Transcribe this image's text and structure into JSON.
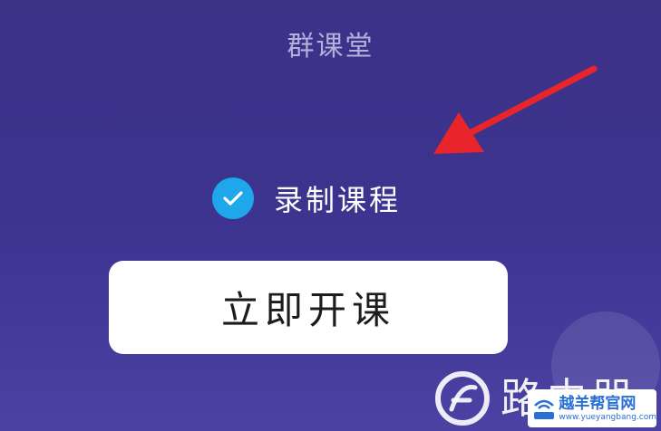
{
  "page": {
    "title": "群课堂"
  },
  "record_option": {
    "label": "录制课程",
    "checked": true
  },
  "start_button": {
    "label": "立即开课"
  },
  "watermark": {
    "text": "路由器",
    "site_name": "越羊帮官网",
    "site_url": "www.yueyangbang.com"
  },
  "colors": {
    "background": "#3b338d",
    "check": "#1fa7ec",
    "arrow": "#e8252b",
    "button": "#ffffff"
  },
  "icons": [
    "check-icon",
    "red-arrow-icon",
    "watermark-logo-icon",
    "badge-router-icon"
  ]
}
